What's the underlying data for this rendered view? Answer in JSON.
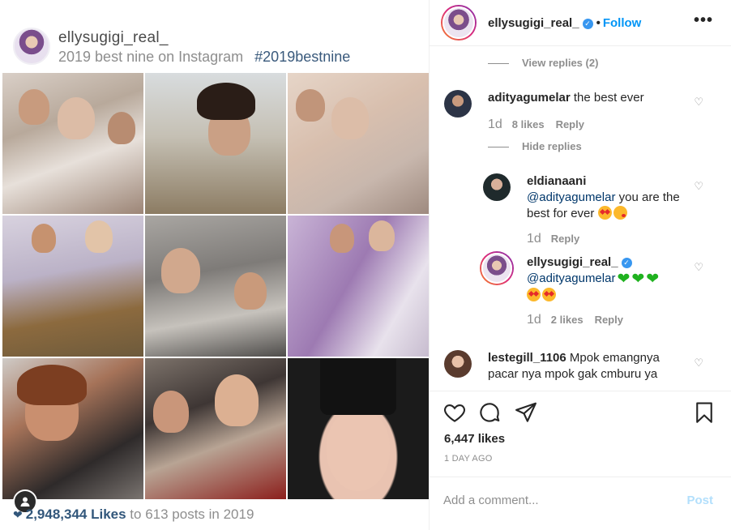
{
  "image_card": {
    "username": "ellysugigi_real_",
    "caption": "2019 best nine on Instagram",
    "hashtag": "#2019bestnine",
    "likes_number": "2,948,344 Likes",
    "likes_suffix": "to 613 posts in 2019"
  },
  "header": {
    "username": "ellysugigi_real_",
    "separator": "•",
    "follow_label": "Follow",
    "more_label": "•••"
  },
  "comments": [
    {
      "kind": "toggle",
      "label": "View replies (2)"
    },
    {
      "kind": "comment",
      "username": "adityagumelar",
      "text": "the best ever",
      "time": "1d",
      "likes": "8 likes",
      "reply": "Reply"
    },
    {
      "kind": "toggle",
      "label": "Hide replies"
    },
    {
      "kind": "reply",
      "username": "eldianaani",
      "mention": "@adityagumelar",
      "text": "you are the best for ever",
      "time": "1d",
      "reply": "Reply"
    },
    {
      "kind": "reply",
      "username": "ellysugigi_real_",
      "mention": "@adityagumelar",
      "time": "1d",
      "likes": "2 likes",
      "reply": "Reply"
    },
    {
      "kind": "comment",
      "username": "lestegill_1106",
      "text": "Mpok emangnya pacar nya mpok gak cmburu ya"
    }
  ],
  "footer": {
    "likes": "6,447 likes",
    "date": "1 DAY AGO",
    "comment_placeholder": "Add a comment...",
    "post_label": "Post"
  },
  "icons": [
    "heart-icon",
    "comment-icon",
    "share-icon",
    "bookmark-icon",
    "verified-icon",
    "more-icon"
  ],
  "colors": {
    "accent": "#0095f6",
    "verified": "#3897f0",
    "muted": "#8e8e8e",
    "link": "#00376b"
  }
}
